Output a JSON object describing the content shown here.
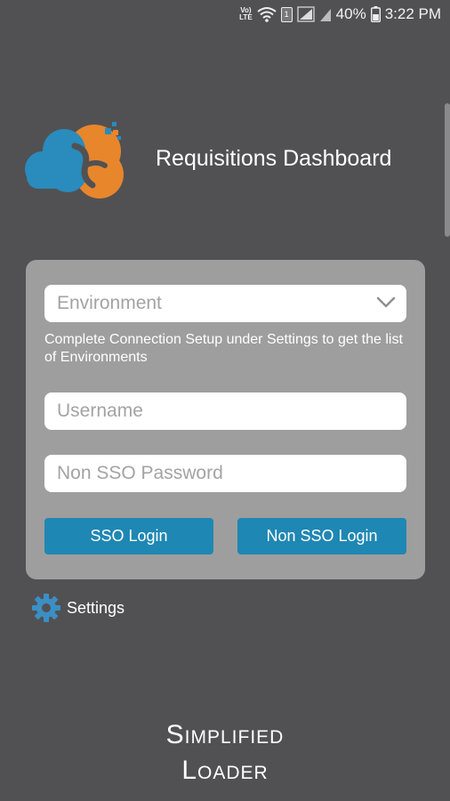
{
  "status_bar": {
    "volte": "Vo)",
    "lte": "LTE",
    "sim_badge": "1",
    "battery_percent": "40%",
    "time": "3:22 PM"
  },
  "header": {
    "title": "Requisitions Dashboard"
  },
  "form": {
    "environment_placeholder": "Environment",
    "helper_text": "Complete Connection Setup under Settings to get the list of Environments",
    "username_placeholder": "Username",
    "password_placeholder": "Non SSO Password",
    "sso_button": "SSO Login",
    "non_sso_button": "Non SSO Login"
  },
  "settings": {
    "label": "Settings"
  },
  "brand": {
    "line1": "Simplified",
    "line2": "Loader"
  },
  "colors": {
    "background": "#515153",
    "card": "#9e9e9e",
    "button": "#1f87b3",
    "logo_blue": "#2a8bbd",
    "logo_orange": "#e8862c",
    "gear": "#3b8fc4"
  },
  "icons": [
    "wifi-icon",
    "sim-icon",
    "signal-icon",
    "battery-icon",
    "chevron-down-icon",
    "gear-icon",
    "cloud-logo-icon"
  ]
}
